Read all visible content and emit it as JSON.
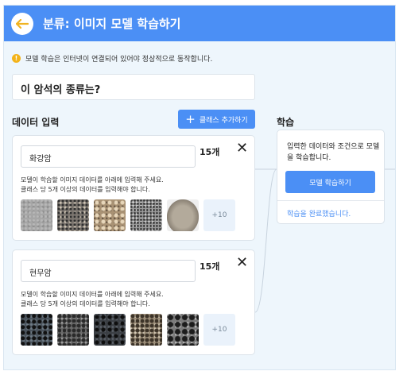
{
  "header": {
    "title": "분류: 이미지 모델 학습하기"
  },
  "notice": {
    "text": "모델 학습은 인터넷이 연결되어 있어야 정상적으로 동작합니다."
  },
  "question": {
    "value": "이 암석의 종류는?"
  },
  "data_input": {
    "title": "데이터 입력",
    "add_class_label": "클래스 추가하기"
  },
  "classes": [
    {
      "name": "화강암",
      "count": "15개",
      "desc_line1": "모델이 학습할 이미지 데이터를 아래에 입력해 주세요.",
      "desc_line2": "클래스 당 5개 이상의 데이터를 입력해야 합니다.",
      "more": "+10"
    },
    {
      "name": "현무암",
      "count": "15개",
      "desc_line1": "모델이 학습할 이미지 데이터를 아래에 입력해 주세요.",
      "desc_line2": "클래스 당 5개 이상의 데이터를 입력해야 합니다.",
      "more": "+10"
    }
  ],
  "training": {
    "title": "학습",
    "description": "입력한 데이터와 조건으로 모델을 학습합니다.",
    "button_label": "모델 학습하기",
    "status": "학습을 완료했습니다."
  },
  "colors": {
    "accent": "#4b8ff5",
    "background": "#eef6fc",
    "notice": "#f3b31a"
  }
}
